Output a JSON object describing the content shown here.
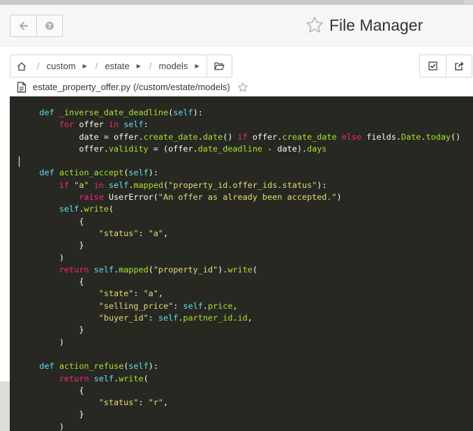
{
  "app": {
    "title": "File Manager"
  },
  "icons": {
    "back": "arrow-left-icon",
    "help": "question-circle-icon",
    "favorite": "star-outline-icon",
    "home": "home-icon",
    "folder": "folder-open-icon",
    "select": "checkbox-check-icon",
    "share": "share-icon",
    "file": "file-text-icon"
  },
  "breadcrumb": {
    "items": [
      "custom",
      "estate",
      "models"
    ],
    "separator": "/"
  },
  "editor": {
    "file_name": "estate_property_offer.py",
    "file_path": "(/custom/estate/models)",
    "code_lines": [
      "    def _inverse_date_deadline(self):",
      "        for offer in self:",
      "            date = offer.create_date.date() if offer.create_date else fields.Date.today()",
      "            offer.validity = (offer.date_deadline - date).days",
      "",
      "    def action_accept(self):",
      "        if \"a\" in self.mapped(\"property_id.offer_ids.status\"):",
      "            raise UserError(\"An offer as already been accepted.\")",
      "        self.write(",
      "            {",
      "                \"status\": \"a\",",
      "            }",
      "        )",
      "        return self.mapped(\"property_id\").write(",
      "            {",
      "                \"state\": \"a\",",
      "                \"selling_price\": self.price,",
      "                \"buyer_id\": self.partner_id.id,",
      "            }",
      "        )",
      "",
      "    def action_refuse(self):",
      "        return self.write(",
      "            {",
      "                \"status\": \"r\",",
      "            }",
      "        )"
    ]
  },
  "colors": {
    "editor_bg": "#272822",
    "keyword": "#f92672",
    "def_keyword": "#66d9ef",
    "function_name": "#a6e22e",
    "string": "#e6db74",
    "text": "#f8f8f2"
  }
}
